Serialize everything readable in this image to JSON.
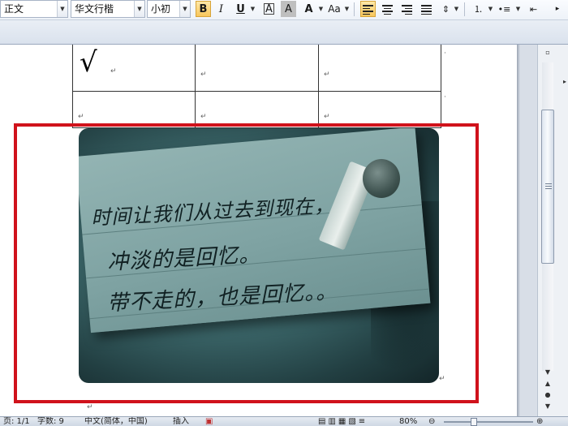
{
  "ribbon": {
    "style_combo": "正文",
    "font_combo": "华文行楷",
    "size_combo": "小初",
    "bold": "B",
    "italic": "I",
    "underline": "U",
    "char_border": "A",
    "char_shading": "A",
    "text_effects": "A",
    "change_case": "Aa"
  },
  "document": {
    "table_checkmark": "√",
    "paragraph_mark": "↵",
    "handwriting": {
      "line1": "时间让我们从过去到现在，",
      "line2": "冲淡的是回忆。",
      "line3": "带不走的，也是回忆。。"
    }
  },
  "statusbar": {
    "page": "页: 1/1",
    "words": "字数: 9",
    "language": "中文(简体，中国)",
    "insert_mode": "插入",
    "zoom": "80%"
  },
  "colors": {
    "selection_border": "#d0121b",
    "active_button": "#f7c65c"
  }
}
